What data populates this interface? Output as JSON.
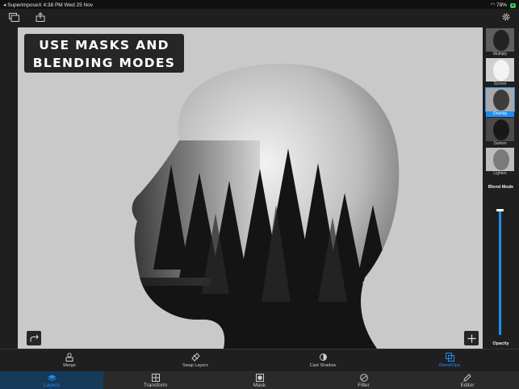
{
  "status_bar": {
    "left": "◂ SuperimposeX  4:38 PM  Wed 25 Nov",
    "battery": "78%",
    "charge_badge": "+"
  },
  "banner": {
    "line1": "USE MASKS AND",
    "line2": "BLENDING MODES"
  },
  "sidebar": {
    "blend_modes": [
      {
        "label": "Multiply",
        "selected": false
      },
      {
        "label": "Screen",
        "selected": false
      },
      {
        "label": "Overlay",
        "selected": true
      },
      {
        "label": "Darken",
        "selected": false
      },
      {
        "label": "Lighten",
        "selected": false
      }
    ],
    "blend_mode_heading": "Blend Mode",
    "opacity_label": "Opacity",
    "opacity_value": 0.95
  },
  "sub_toolbar": [
    {
      "label": "Merge",
      "icon": "merge-icon",
      "selected": false
    },
    {
      "label": "Swap Layers",
      "icon": "swap-icon",
      "selected": false
    },
    {
      "label": "Cast Shadow",
      "icon": "shadow-icon",
      "selected": false
    },
    {
      "label": "Blend/Opa",
      "icon": "blend-icon",
      "selected": true
    }
  ],
  "tabs": [
    {
      "label": "Layers",
      "icon": "layers-icon",
      "selected": true
    },
    {
      "label": "Transform",
      "icon": "transform-icon",
      "selected": false
    },
    {
      "label": "Mask",
      "icon": "mask-icon",
      "selected": false
    },
    {
      "label": "Filter",
      "icon": "filter-icon",
      "selected": false
    },
    {
      "label": "Editor",
      "icon": "editor-icon",
      "selected": false
    }
  ],
  "colors": {
    "accent": "#1f8ef1",
    "background": "#1f1f1f",
    "canvas": "#cbcbcb"
  }
}
